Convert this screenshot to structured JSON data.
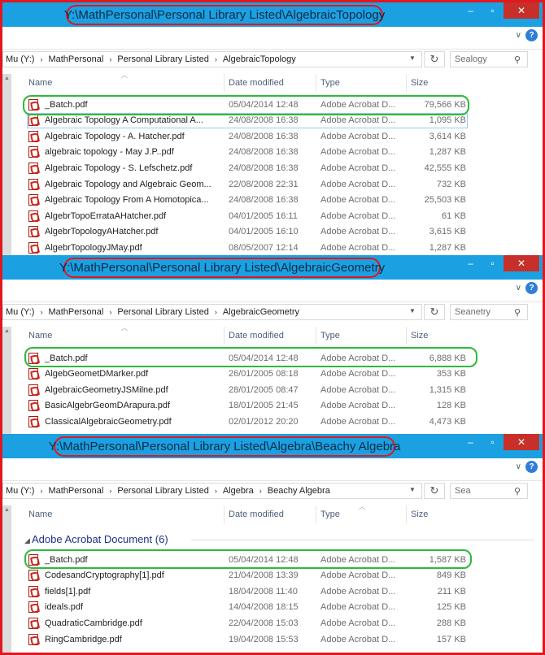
{
  "windows": [
    {
      "title": "Y:\\MathPersonal\\Personal Library Listed\\AlgebraicTopology",
      "breadcrumbs": [
        "Mu (Y:)",
        "MathPersonal",
        "Personal Library Listed",
        "AlgebraicTopology"
      ],
      "search_placeholder": "Sealogy",
      "columns": [
        "Name",
        "Date modified",
        "Type",
        "Size"
      ],
      "rows": [
        {
          "name": "_Batch.pdf",
          "date": "05/04/2014 12:48",
          "type": "Adobe Acrobat D...",
          "size": "79,566 KB"
        },
        {
          "name": "Algebraic Topology  A Computational A...",
          "date": "24/08/2008 16:38",
          "type": "Adobe Acrobat D...",
          "size": "1,095 KB"
        },
        {
          "name": "Algebraic Topology - A. Hatcher.pdf",
          "date": "24/08/2008 16:38",
          "type": "Adobe Acrobat D...",
          "size": "3,614 KB"
        },
        {
          "name": "algebraic topology - May J.P..pdf",
          "date": "24/08/2008 16:38",
          "type": "Adobe Acrobat D...",
          "size": "1,287 KB"
        },
        {
          "name": "Algebraic Topology - S. Lefschetz.pdf",
          "date": "24/08/2008 16:38",
          "type": "Adobe Acrobat D...",
          "size": "42,555 KB"
        },
        {
          "name": "Algebraic Topology and Algebraic Geom...",
          "date": "22/08/2008 22:31",
          "type": "Adobe Acrobat D...",
          "size": "732 KB"
        },
        {
          "name": "Algebraic Topology From A Homotopica...",
          "date": "24/08/2008 16:38",
          "type": "Adobe Acrobat D...",
          "size": "25,503 KB"
        },
        {
          "name": "AlgebrTopoErrataAHatcher.pdf",
          "date": "04/01/2005 16:11",
          "type": "Adobe Acrobat D...",
          "size": "61 KB"
        },
        {
          "name": "AlgebrTopologyAHatcher.pdf",
          "date": "04/01/2005 16:10",
          "type": "Adobe Acrobat D...",
          "size": "3,615 KB"
        },
        {
          "name": "AlgebrTopologyJMay.pdf",
          "date": "08/05/2007 12:14",
          "type": "Adobe Acrobat D...",
          "size": "1,287 KB"
        }
      ]
    },
    {
      "title": "Y:\\MathPersonal\\Personal Library Listed\\AlgebraicGeometry",
      "breadcrumbs": [
        "Mu (Y:)",
        "MathPersonal",
        "Personal Library Listed",
        "AlgebraicGeometry"
      ],
      "search_placeholder": "Seanetry",
      "columns": [
        "Name",
        "Date modified",
        "Type",
        "Size"
      ],
      "rows": [
        {
          "name": "_Batch.pdf",
          "date": "05/04/2014 12:48",
          "type": "Adobe Acrobat D...",
          "size": "6,888 KB"
        },
        {
          "name": "AlgebGeometDMarker.pdf",
          "date": "26/01/2005 08:18",
          "type": "Adobe Acrobat D...",
          "size": "353 KB"
        },
        {
          "name": "AlgebraicGeometryJSMilne.pdf",
          "date": "28/01/2005 08:47",
          "type": "Adobe Acrobat D...",
          "size": "1,315 KB"
        },
        {
          "name": "BasicAlgebrGeomDArapura.pdf",
          "date": "18/01/2005 21:45",
          "type": "Adobe Acrobat D...",
          "size": "128 KB"
        },
        {
          "name": "ClassicalAlgebraicGeometry.pdf",
          "date": "02/01/2012 20:20",
          "type": "Adobe Acrobat D...",
          "size": "4,473 KB"
        }
      ]
    },
    {
      "title": "Y:\\MathPersonal\\Personal Library Listed\\Algebra\\Beachy Algebra",
      "breadcrumbs": [
        "Mu (Y:)",
        "MathPersonal",
        "Personal Library Listed",
        "Algebra",
        "Beachy Algebra"
      ],
      "search_placeholder": "Sea",
      "columns": [
        "Name",
        "Date modified",
        "Type",
        "Size"
      ],
      "group_header": "Adobe Acrobat Document (6)",
      "rows": [
        {
          "name": "_Batch.pdf",
          "date": "05/04/2014 12:48",
          "type": "Adobe Acrobat D...",
          "size": "1,587 KB"
        },
        {
          "name": "CodesandCryptography[1].pdf",
          "date": "21/04/2008 13:39",
          "type": "Adobe Acrobat D...",
          "size": "849 KB"
        },
        {
          "name": "fields[1].pdf",
          "date": "18/04/2008 11:40",
          "type": "Adobe Acrobat D...",
          "size": "211 KB"
        },
        {
          "name": "ideals.pdf",
          "date": "14/04/2008 18:15",
          "type": "Adobe Acrobat D...",
          "size": "125 KB"
        },
        {
          "name": "QuadraticCambridge.pdf",
          "date": "22/04/2008 15:03",
          "type": "Adobe Acrobat D...",
          "size": "288 KB"
        },
        {
          "name": "RingCambridge.pdf",
          "date": "19/04/2008 15:53",
          "type": "Adobe Acrobat D...",
          "size": "157 KB"
        }
      ]
    }
  ],
  "icons": {
    "pdf": "pdf-file-icon",
    "refresh": "refresh-icon",
    "search": "search-icon",
    "help": "help-icon",
    "close": "close-icon",
    "minimize": "minimize-icon",
    "maximize": "maximize-icon"
  },
  "colors": {
    "title_bar": "#1ba1e2",
    "close_button": "#c7302a",
    "red_highlight": "#e0181f",
    "green_highlight": "#2dba3a",
    "group_header": "#1e3287"
  }
}
